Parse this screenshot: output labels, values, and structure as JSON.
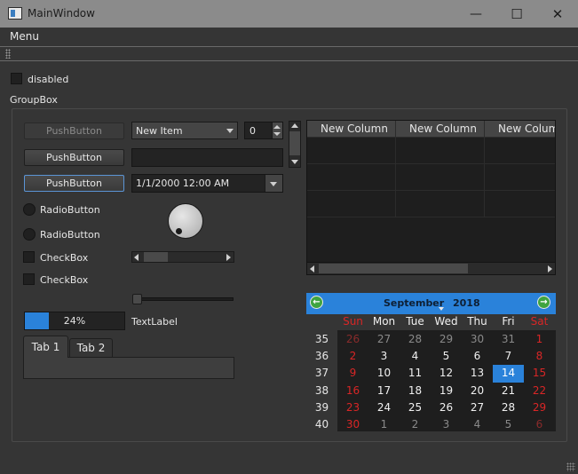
{
  "window": {
    "title": "MainWindow",
    "minimize_glyph": "—",
    "maximize_glyph": "☐",
    "close_glyph": "✕"
  },
  "menubar": {
    "menu_label": "Menu"
  },
  "top": {
    "disabled_label": "disabled",
    "groupbox_title": "GroupBox"
  },
  "left": {
    "pushbutton_disabled": "PushButton",
    "pushbutton_2": "PushButton",
    "pushbutton_3": "PushButton",
    "combo_value": "New Item",
    "spin_value": "0",
    "datetime_value": "1/1/2000 12:00 AM",
    "radio_1": "RadioButton",
    "radio_2": "RadioButton",
    "check_1": "CheckBox",
    "check_2": "CheckBox",
    "progress_value": 24,
    "progress_text": "24%",
    "text_label": "TextLabel",
    "tabs": [
      "Tab 1",
      "Tab 2"
    ]
  },
  "table": {
    "headers": [
      "New Column",
      "New Column",
      "New Column"
    ]
  },
  "calendar": {
    "month": "September",
    "year": "2018",
    "day_headers": [
      "Sun",
      "Mon",
      "Tue",
      "Wed",
      "Thu",
      "Fri",
      "Sat"
    ],
    "week_numbers": [
      "35",
      "36",
      "37",
      "38",
      "39",
      "40"
    ],
    "weeks": [
      [
        "26",
        "27",
        "28",
        "29",
        "30",
        "31",
        "1"
      ],
      [
        "2",
        "3",
        "4",
        "5",
        "6",
        "7",
        "8"
      ],
      [
        "9",
        "10",
        "11",
        "12",
        "13",
        "14",
        "15"
      ],
      [
        "16",
        "17",
        "18",
        "19",
        "20",
        "21",
        "22"
      ],
      [
        "23",
        "24",
        "25",
        "26",
        "27",
        "28",
        "29"
      ],
      [
        "30",
        "1",
        "2",
        "3",
        "4",
        "5",
        "6"
      ]
    ],
    "selected_day": "14"
  },
  "colors": {
    "accent": "#2a82da",
    "weekend": "#d92626",
    "background": "#353535"
  }
}
